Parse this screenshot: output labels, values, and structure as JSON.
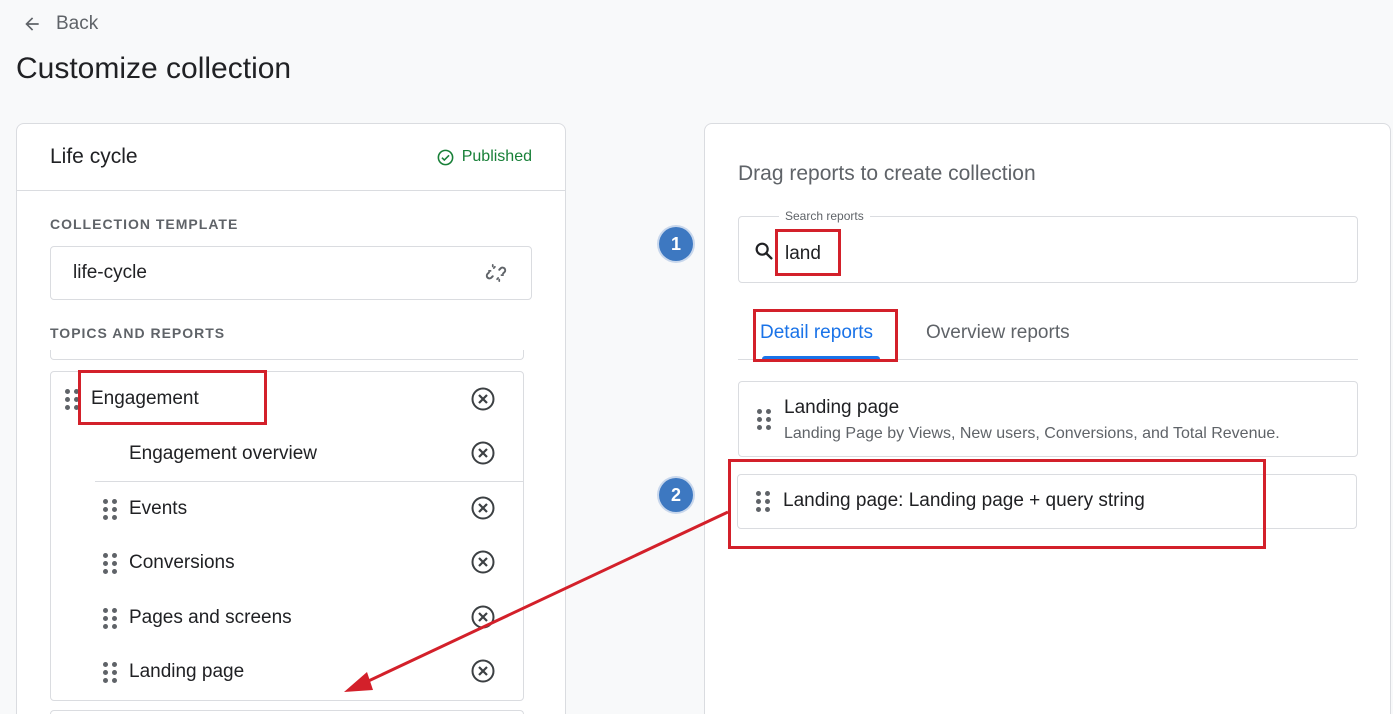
{
  "header": {
    "back_label": "Back",
    "page_title": "Customize collection"
  },
  "left_panel": {
    "title": "Life cycle",
    "status": "Published",
    "status_color": "#188038",
    "template_section_label": "COLLECTION TEMPLATE",
    "template_value": "life-cycle",
    "topics_section_label": "TOPICS AND REPORTS",
    "topic": {
      "name": "Engagement",
      "reports": [
        {
          "label": "Engagement overview"
        },
        {
          "label": "Events"
        },
        {
          "label": "Conversions"
        },
        {
          "label": "Pages and screens"
        },
        {
          "label": "Landing page"
        }
      ]
    }
  },
  "right_panel": {
    "title": "Drag reports to create collection",
    "search": {
      "label": "Search reports",
      "value": "land"
    },
    "tabs": [
      {
        "label": "Detail reports",
        "active": true
      },
      {
        "label": "Overview reports",
        "active": false
      }
    ],
    "results": [
      {
        "title": "Landing page",
        "description": "Landing Page by Views, New users, Conversions, and Total Revenue."
      },
      {
        "title": "Landing page: Landing page + query string",
        "description": ""
      }
    ]
  },
  "annotations": {
    "badge_1": "1",
    "badge_2": "2",
    "highlight_color": "#d3202a",
    "badge_color": "#3d78c1"
  },
  "accent_color": "#1a73e8",
  "icons": [
    "arrow-back-icon",
    "check-circle-icon",
    "link-off-icon",
    "drag-handle-icon",
    "remove-circle-icon",
    "search-icon"
  ]
}
